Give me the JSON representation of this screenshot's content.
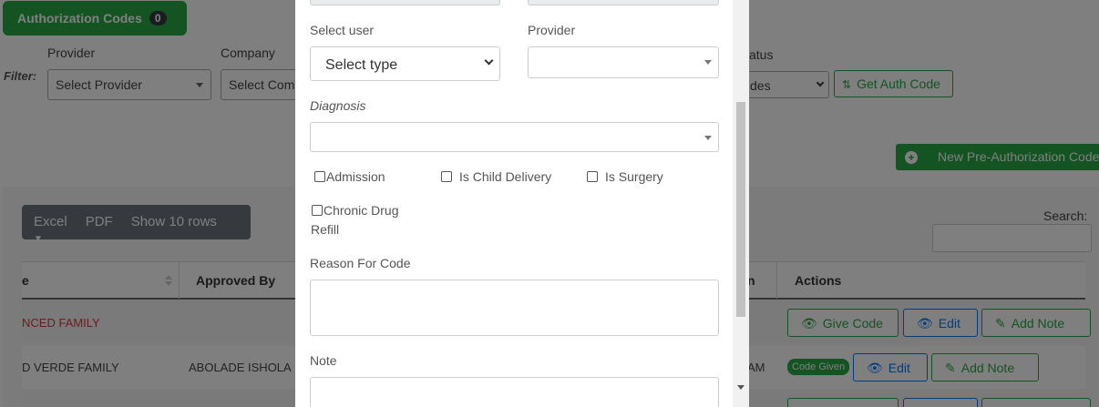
{
  "header": {
    "title": "Authorization Codes",
    "count": "0"
  },
  "filters": {
    "filter_label": "Filter:",
    "provider_label": "Provider",
    "provider_value": "Select Provider",
    "company_label": "Company",
    "company_value": "Select Com",
    "status_label": "atus",
    "status_value": "des",
    "get_auth_button": "Get Auth Code"
  },
  "new_button": "New Pre-Authorization Code",
  "table_tools": {
    "excel": "Excel",
    "pdf": "PDF",
    "show_rows": "Show 10 rows",
    "search_label": "Search:"
  },
  "table": {
    "headers": [
      "e",
      "Approved By",
      "n",
      "Actions"
    ],
    "rows": [
      {
        "name": "NCED FAMILY",
        "approved_by": "",
        "col_n": "",
        "actions": [
          "Give Code",
          "Edit",
          "Add Note"
        ]
      },
      {
        "name": "D VERDE FAMILY",
        "approved_by": "ABOLADE ISHOLA",
        "col_n": "AM",
        "badge": "Code Given",
        "actions": [
          "Edit",
          "Add Note"
        ]
      }
    ]
  },
  "modal": {
    "select_user_label": "Select user",
    "select_user_value": "Select type",
    "provider_label": "Provider",
    "provider_value": "",
    "diagnosis_label": "Diagnosis",
    "diagnosis_value": "",
    "checkboxes": [
      "Admission",
      "Is Child Delivery",
      "Is Surgery"
    ],
    "chronic_line1": "Chronic Drug",
    "chronic_line2": "Refill",
    "reason_label": "Reason For Code",
    "note_label": "Note"
  },
  "colors": {
    "primary_green": "#28a745",
    "primary_blue": "#007bff",
    "danger_red": "#dc3545",
    "overlay": "rgba(0,0,0,0.5)"
  }
}
